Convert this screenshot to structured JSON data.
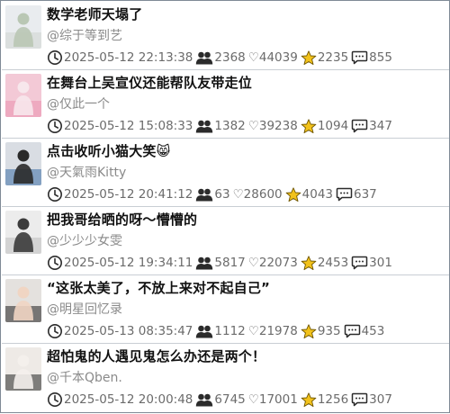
{
  "items": [
    {
      "title": "数学老师天塌了",
      "author": "@综于等到艺",
      "time": "2025-05-12 22:13:38",
      "followers": "2368",
      "likes": "♡44039",
      "stars": "2235",
      "comments": "855",
      "thumb": {
        "bg": "#e9ecef",
        "accent": "#cfd6cf",
        "fig": "#b9c7b4"
      }
    },
    {
      "title": "在舞台上吴宣仪还能帮队友带走位",
      "author": "@仅此一个",
      "time": "2025-05-12 15:08:33",
      "followers": "1382",
      "likes": "♡39238",
      "stars": "1094",
      "comments": "347",
      "thumb": {
        "bg": "#f3c9d6",
        "accent": "#e98fae",
        "fig": "#f7e7ec"
      }
    },
    {
      "title": "点击收听小猫大笑😸",
      "author": "@天氣雨Kitty",
      "time": "2025-05-12 20:41:12",
      "followers": "63",
      "likes": "♡28600",
      "stars": "4043",
      "comments": "637",
      "thumb": {
        "bg": "#d9dde3",
        "accent": "#3d6ea5",
        "fig": "#2a2a2a"
      }
    },
    {
      "title": "把我哥给晒的呀～懵懵的",
      "author": "@少少少女雯",
      "time": "2025-05-12 19:34:11",
      "followers": "5817",
      "likes": "♡22073",
      "stars": "2453",
      "comments": "301",
      "thumb": {
        "bg": "#ececec",
        "accent": "#bfbfbf",
        "fig": "#3b3b3b"
      }
    },
    {
      "title": "“这张太美了，不放上来对不起自己”",
      "author": "@明星回忆录",
      "time": "2025-05-13 08:35:47",
      "followers": "1112",
      "likes": "♡21978",
      "stars": "935",
      "comments": "453",
      "thumb": {
        "bg": "#e4e1de",
        "accent": "#1e1e1e",
        "fig": "#f0d5c3"
      }
    },
    {
      "title": "超怕鬼的人遇见鬼怎么办还是两个！",
      "author": "@千本Qben.",
      "time": "2025-05-12 20:00:48",
      "followers": "6745",
      "likes": "♡17001",
      "stars": "1256",
      "comments": "307",
      "thumb": {
        "bg": "#eeeae6",
        "accent": "#222222",
        "fig": "#f4f0ec"
      }
    }
  ],
  "colors": {
    "star": "#f2c21b",
    "starStroke": "#6e5500",
    "icon": "#2b2b2b",
    "text_muted": "#6b6b6b",
    "border": "#c9ced4"
  },
  "icons": {
    "time": "clock-icon",
    "followers": "users-icon",
    "likes": "heart-icon",
    "stars": "star-icon",
    "comments": "comment-icon"
  }
}
